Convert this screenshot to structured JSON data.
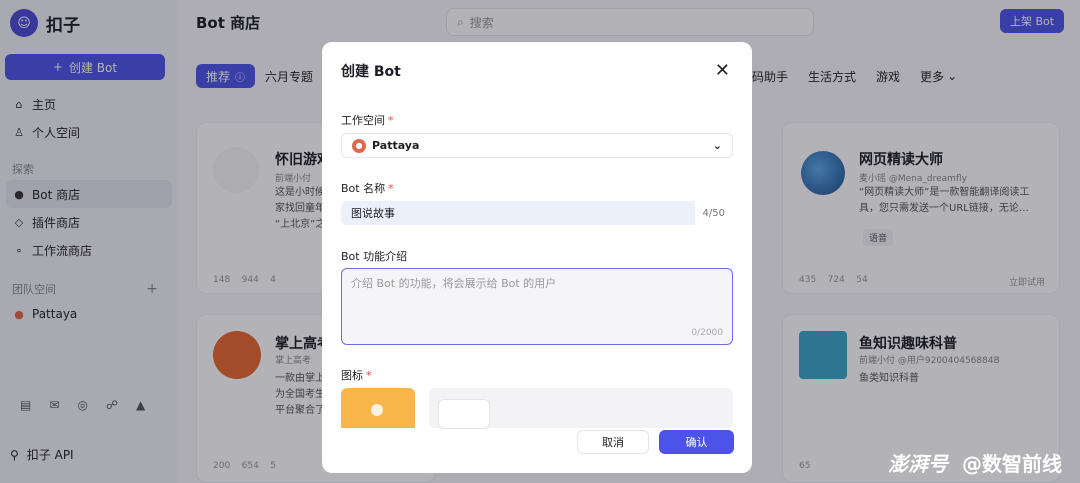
{
  "app": {
    "name": "扣子",
    "logo_icon": "coze-logo-icon"
  },
  "sidebar": {
    "create_label": "创建 Bot",
    "nav": [
      {
        "label": "主页",
        "icon": "home-icon"
      },
      {
        "label": "个人空间",
        "icon": "user-icon"
      }
    ],
    "explore_title": "探索",
    "explore": [
      {
        "label": "Bot 商店",
        "icon": "bot-icon"
      },
      {
        "label": "插件商店",
        "icon": "plugin-icon"
      },
      {
        "label": "工作流商店",
        "icon": "workflow-icon"
      }
    ],
    "team_title": "团队空间",
    "team": [
      {
        "label": "Pattaya",
        "icon": "team-avatar-icon"
      }
    ],
    "api_label": "扣子 API"
  },
  "header": {
    "title": "Bot 商店",
    "search_placeholder": "搜索",
    "publish_label": "上架 Bot"
  },
  "tabs": {
    "left": [
      "推荐",
      "六月专题"
    ],
    "right": [
      "代码助手",
      "生活方式",
      "游戏",
      "更多"
    ]
  },
  "cards": [
    {
      "title": "怀旧游戏",
      "author": "前端小付",
      "desc": "这是小时候…\n家找回童年…\n“上北京”之…",
      "stats": [
        "148",
        "944",
        "4"
      ]
    },
    {
      "title": "网页精读大师",
      "author": "麦小瑶 @Mena_dreamfly",
      "desc": "“网页精读大师”是一款智能翻译阅读工具，您只需发送一个URL链接，无论…",
      "tag": "语音",
      "stats": [
        "435",
        "724",
        "54"
      ],
      "extra": "立即试用"
    },
    {
      "title": "掌上高考",
      "author": "掌上高考",
      "desc": "一款由掌上…\n为全国考生…\n平台聚合了…",
      "stats": [
        "200",
        "654",
        "5"
      ]
    },
    {
      "title": "鱼知识趣味科普",
      "author": "前端小付 @用户920040456884B",
      "desc": "鱼类知识科普",
      "stats": [
        "65"
      ]
    }
  ],
  "modal": {
    "title": "创建 Bot",
    "workspace_label": "工作空间",
    "workspace_value": "Pattaya",
    "name_label": "Bot 名称",
    "name_value": "图说故事",
    "name_count": "4/50",
    "desc_label": "Bot 功能介绍",
    "desc_placeholder": "介绍 Bot 的功能，将会展示给 Bot 的用户",
    "desc_count": "0/2000",
    "icon_label": "图标",
    "cancel_label": "取消",
    "confirm_label": "确认"
  },
  "watermark": {
    "brand": "澎湃号",
    "account": "@数智前线"
  },
  "colors": {
    "accent": "#4d53e8",
    "required": "#f53f3f",
    "overlay": "rgba(20,20,30,0.32)"
  }
}
